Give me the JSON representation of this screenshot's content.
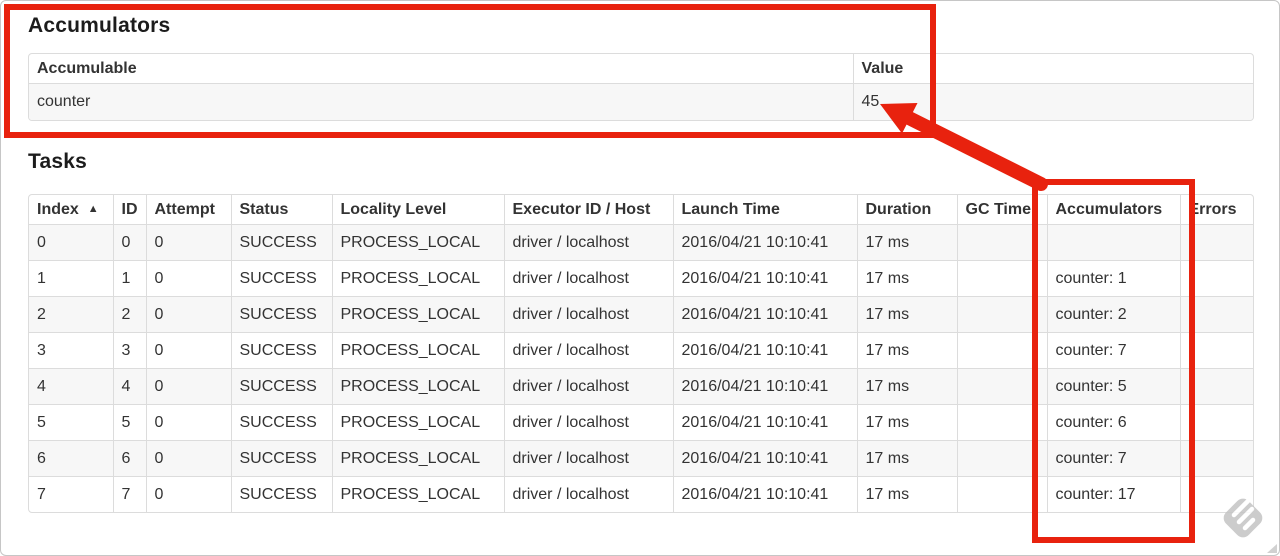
{
  "accumulators_section": {
    "heading": "Accumulators",
    "columns": [
      "Accumulable",
      "Value"
    ],
    "rows": [
      {
        "accumulable": "counter",
        "value": "45"
      }
    ]
  },
  "tasks_section": {
    "heading": "Tasks",
    "columns": [
      "Index",
      "ID",
      "Attempt",
      "Status",
      "Locality Level",
      "Executor ID / Host",
      "Launch Time",
      "Duration",
      "GC Time",
      "Accumulators",
      "Errors"
    ],
    "sort": {
      "column": "Index",
      "direction": "ascending",
      "indicator_glyph": "▲"
    },
    "rows": [
      {
        "index": "0",
        "id": "0",
        "attempt": "0",
        "status": "SUCCESS",
        "locality_level": "PROCESS_LOCAL",
        "executor_id_host": "driver / localhost",
        "launch_time": "2016/04/21 10:10:41",
        "duration": "17 ms",
        "gc_time": "",
        "accumulators": "",
        "errors": ""
      },
      {
        "index": "1",
        "id": "1",
        "attempt": "0",
        "status": "SUCCESS",
        "locality_level": "PROCESS_LOCAL",
        "executor_id_host": "driver / localhost",
        "launch_time": "2016/04/21 10:10:41",
        "duration": "17 ms",
        "gc_time": "",
        "accumulators": "counter: 1",
        "errors": ""
      },
      {
        "index": "2",
        "id": "2",
        "attempt": "0",
        "status": "SUCCESS",
        "locality_level": "PROCESS_LOCAL",
        "executor_id_host": "driver / localhost",
        "launch_time": "2016/04/21 10:10:41",
        "duration": "17 ms",
        "gc_time": "",
        "accumulators": "counter: 2",
        "errors": ""
      },
      {
        "index": "3",
        "id": "3",
        "attempt": "0",
        "status": "SUCCESS",
        "locality_level": "PROCESS_LOCAL",
        "executor_id_host": "driver / localhost",
        "launch_time": "2016/04/21 10:10:41",
        "duration": "17 ms",
        "gc_time": "",
        "accumulators": "counter: 7",
        "errors": ""
      },
      {
        "index": "4",
        "id": "4",
        "attempt": "0",
        "status": "SUCCESS",
        "locality_level": "PROCESS_LOCAL",
        "executor_id_host": "driver / localhost",
        "launch_time": "2016/04/21 10:10:41",
        "duration": "17 ms",
        "gc_time": "",
        "accumulators": "counter: 5",
        "errors": ""
      },
      {
        "index": "5",
        "id": "5",
        "attempt": "0",
        "status": "SUCCESS",
        "locality_level": "PROCESS_LOCAL",
        "executor_id_host": "driver / localhost",
        "launch_time": "2016/04/21 10:10:41",
        "duration": "17 ms",
        "gc_time": "",
        "accumulators": "counter: 6",
        "errors": ""
      },
      {
        "index": "6",
        "id": "6",
        "attempt": "0",
        "status": "SUCCESS",
        "locality_level": "PROCESS_LOCAL",
        "executor_id_host": "driver / localhost",
        "launch_time": "2016/04/21 10:10:41",
        "duration": "17 ms",
        "gc_time": "",
        "accumulators": "counter: 7",
        "errors": ""
      },
      {
        "index": "7",
        "id": "7",
        "attempt": "0",
        "status": "SUCCESS",
        "locality_level": "PROCESS_LOCAL",
        "executor_id_host": "driver / localhost",
        "launch_time": "2016/04/21 10:10:41",
        "duration": "17 ms",
        "gc_time": "",
        "accumulators": "counter: 17",
        "errors": ""
      }
    ]
  },
  "annotations": {
    "color": "#e8220e",
    "box1_label": "highlight-accumulators-summary",
    "box2_label": "highlight-accumulators-column",
    "arrow_label": "arrow-to-value-45"
  },
  "watermark": {
    "icon": "stamp-diamond-icon",
    "color": "#c4c4c4"
  }
}
